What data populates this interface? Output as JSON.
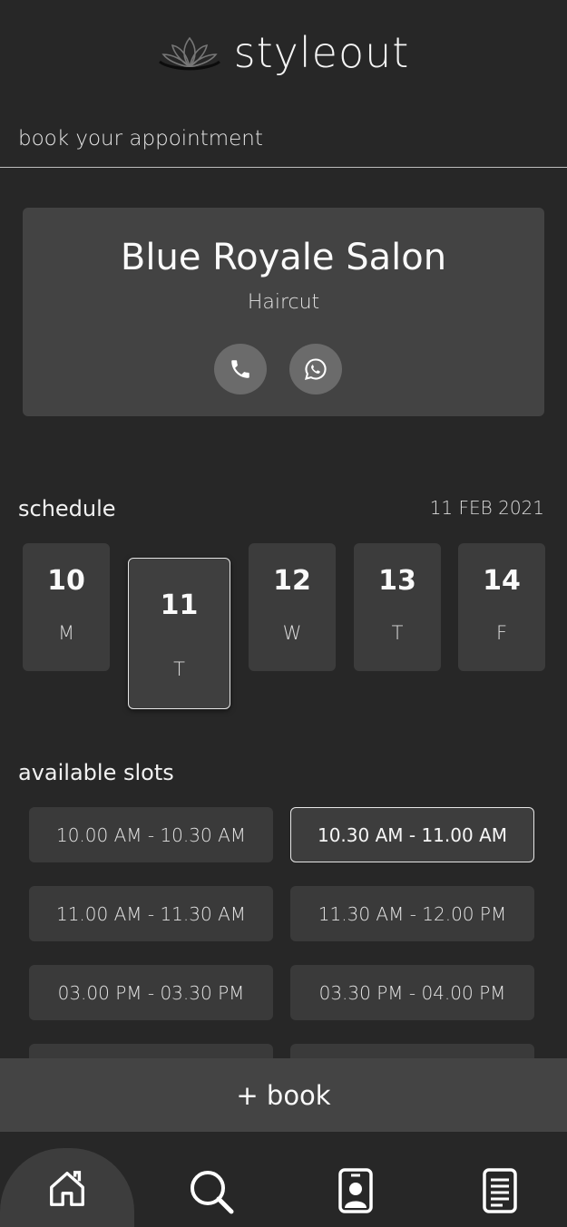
{
  "brand": {
    "name": "styleout",
    "logo_icon": "lotus-icon"
  },
  "header": {
    "subtitle": "book your appointment"
  },
  "salon": {
    "name": "Blue Royale Salon",
    "service": "Haircut",
    "actions": [
      {
        "icon": "phone-icon"
      },
      {
        "icon": "whatsapp-icon"
      }
    ]
  },
  "schedule": {
    "label": "schedule",
    "date": "11 FEB 2021",
    "days": [
      {
        "num": "10",
        "weekday": "M"
      },
      {
        "num": "11",
        "weekday": "T",
        "selected": true
      },
      {
        "num": "12",
        "weekday": "W"
      },
      {
        "num": "13",
        "weekday": "T"
      },
      {
        "num": "14",
        "weekday": "F"
      }
    ]
  },
  "slots": {
    "label": "available slots",
    "items": [
      "10.00 AM - 10.30 AM",
      "10.30 AM - 11.00 AM",
      "11.00 AM - 11.30 AM",
      "11.30 AM - 12.00 PM",
      "03.00 PM - 03.30 PM",
      "03.30 PM - 04.00 PM"
    ],
    "selected_index": 1
  },
  "book": {
    "label": "+ book"
  },
  "nav": [
    {
      "icon": "home-icon",
      "active": true
    },
    {
      "icon": "search-icon"
    },
    {
      "icon": "profile-card-icon"
    },
    {
      "icon": "document-list-icon"
    }
  ],
  "colors": {
    "background": "#272727",
    "card": "#434343",
    "tile": "#3c3c3c",
    "accent_border": "#e6e6e6"
  }
}
